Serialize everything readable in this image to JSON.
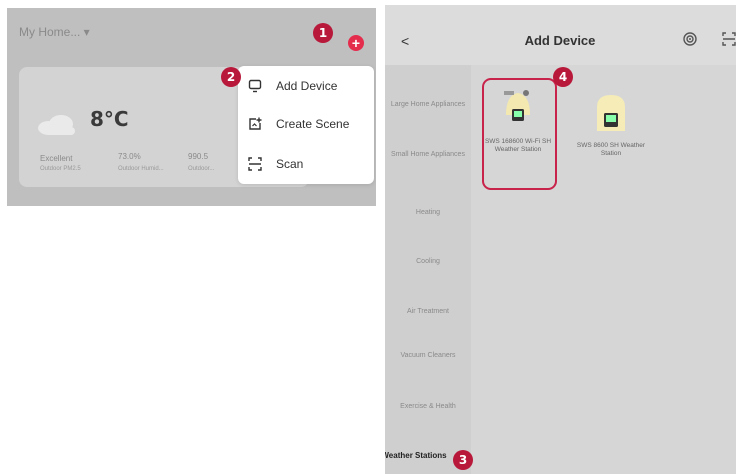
{
  "left_panel": {
    "home_selector": "My Home... ▾",
    "weather": {
      "temperature": "8°C",
      "stats": [
        {
          "value": "Excellent",
          "label": "Outdoor PM2.5"
        },
        {
          "value": "73.0%",
          "label": "Outdoor Humid..."
        },
        {
          "value": "990.5",
          "label": "Outdoor..."
        }
      ]
    },
    "add_button": "+",
    "menu": {
      "items": [
        {
          "label": "Add Device"
        },
        {
          "label": "Create Scene"
        },
        {
          "label": "Scan"
        }
      ]
    }
  },
  "right_panel": {
    "title": "Add Device",
    "back_label": "<",
    "categories": [
      {
        "label": "Large Home Appliances"
      },
      {
        "label": "Small Home Appliances"
      },
      {
        "label": "Heating"
      },
      {
        "label": "Cooling"
      },
      {
        "label": "Air Treatment"
      },
      {
        "label": "Vacuum Cleaners"
      },
      {
        "label": "Exercise & Health"
      },
      {
        "label": "Weather Stations"
      }
    ],
    "devices": [
      {
        "label": "SWS 168600 Wi-Fi SH Weather Station"
      },
      {
        "label": "SWS 8600 SH Weather Station"
      }
    ]
  },
  "callouts": [
    "1",
    "2",
    "3",
    "4"
  ],
  "colors": {
    "accent": "#e42c4d",
    "callout": "#b8183a",
    "highlight_border": "#c8234a"
  }
}
